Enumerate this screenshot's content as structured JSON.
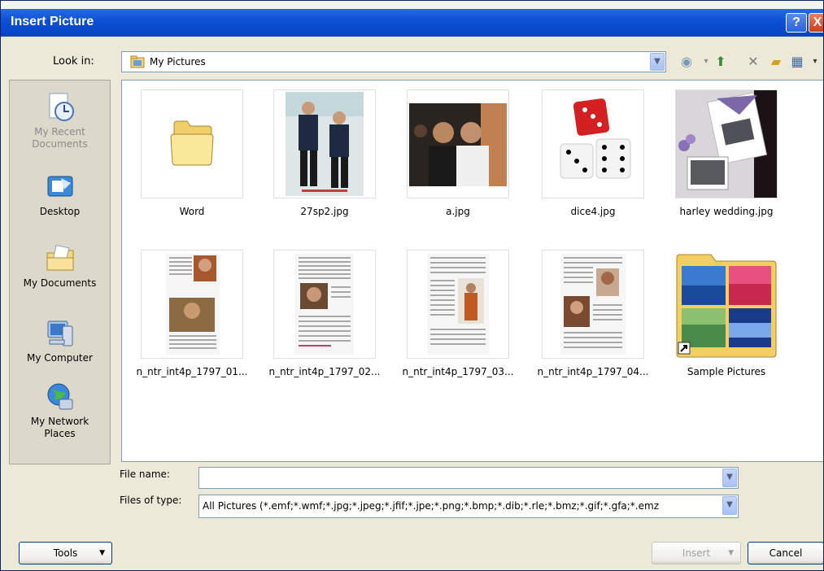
{
  "title": "Insert Picture",
  "title_buttons": {
    "help": "?",
    "close": "X"
  },
  "look_in": {
    "label": "Look in:",
    "value": "My Pictures"
  },
  "places": [
    {
      "label_lines": [
        "My Recent",
        "Documents"
      ],
      "icon": "recent-documents-icon"
    },
    {
      "label_lines": [
        "Desktop",
        ""
      ],
      "icon": "desktop-icon"
    },
    {
      "label_lines": [
        "My Documents",
        ""
      ],
      "icon": "my-documents-icon"
    },
    {
      "label_lines": [
        "My Computer",
        ""
      ],
      "icon": "my-computer-icon"
    },
    {
      "label_lines": [
        "My Network",
        "Places"
      ],
      "icon": "network-places-icon"
    }
  ],
  "items": [
    {
      "name": "Word",
      "type": "folder"
    },
    {
      "name": "27sp2.jpg",
      "type": "image"
    },
    {
      "name": "a.jpg",
      "type": "image"
    },
    {
      "name": "dice4.jpg",
      "type": "image"
    },
    {
      "name": "harley wedding.jpg",
      "type": "image"
    },
    {
      "name": "n_ntr_int4p_1797_01...",
      "type": "image"
    },
    {
      "name": "n_ntr_int4p_1797_02...",
      "type": "image"
    },
    {
      "name": "n_ntr_int4p_1797_03...",
      "type": "image"
    },
    {
      "name": "n_ntr_int4p_1797_04...",
      "type": "image"
    },
    {
      "name": "Sample Pictures",
      "type": "shortcut-folder"
    }
  ],
  "file_name": {
    "label": "File name:",
    "value": ""
  },
  "files_of_type": {
    "label": "Files of type:",
    "value": "All Pictures (*.emf;*.wmf;*.jpg;*.jpeg;*.jfif;*.jpe;*.png;*.bmp;*.dib;*.rle;*.bmz;*.gif;*.gfa;*.emz"
  },
  "buttons": {
    "tools": "Tools",
    "insert": "Insert",
    "cancel": "Cancel"
  },
  "colors": {
    "titlebar": "#0a4fd4",
    "accent_border": "#7f9db9"
  }
}
